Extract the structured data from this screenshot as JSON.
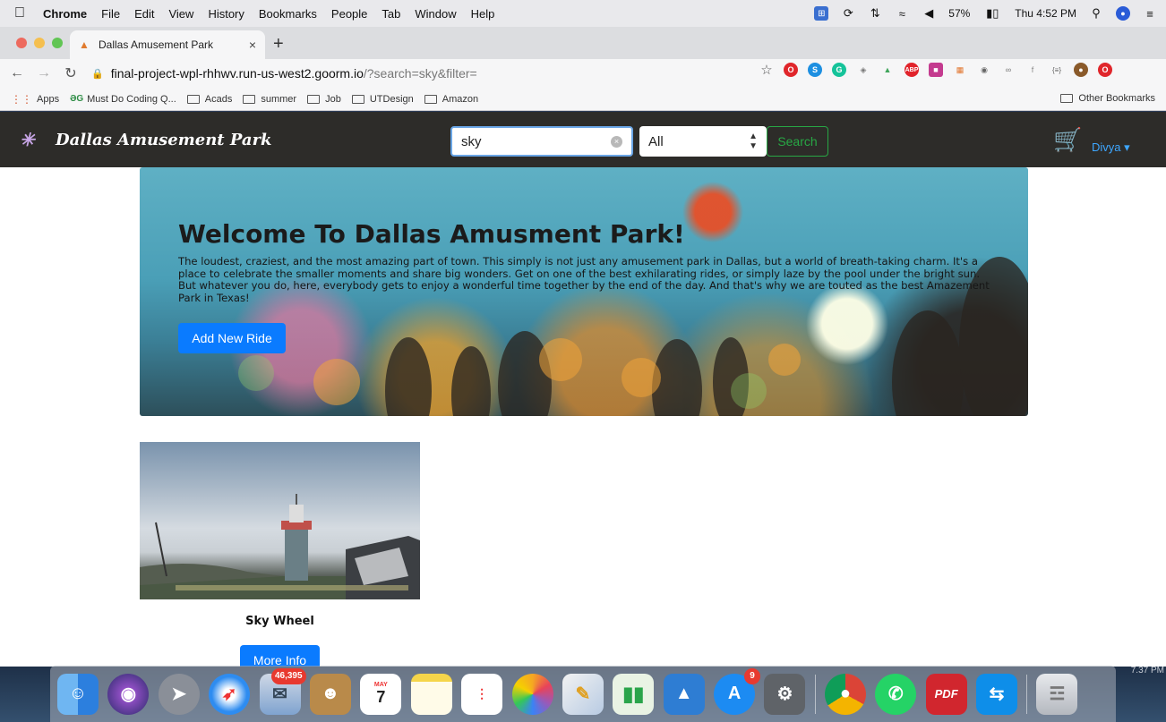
{
  "menubar": {
    "app": "Chrome",
    "items": [
      "File",
      "Edit",
      "View",
      "History",
      "Bookmarks",
      "People",
      "Tab",
      "Window",
      "Help"
    ],
    "battery": "57%",
    "clock": "Thu 4:52 PM"
  },
  "tab": {
    "title": "Dallas Amusement Park"
  },
  "address": {
    "host": "final-project-wpl-rhhwv.run-us-west2.goorm.io",
    "path": "/?search=sky&filter="
  },
  "bookmarks": {
    "items": [
      "Apps",
      "Must Do Coding Q...",
      "Acads",
      "summer",
      "Job",
      "UTDesign",
      "Amazon"
    ],
    "other": "Other Bookmarks"
  },
  "site": {
    "brand": "Dallas Amusement Park",
    "search_value": "sky",
    "filter_value": "All",
    "search_button": "Search",
    "user": "Divya"
  },
  "hero": {
    "title": "Welcome To Dallas Amusment Park!",
    "text": "The loudest, craziest, and the most amazing part of town. This simply is not just any amusement park in Dallas, but a world of breath-taking charm. It's a place to celebrate the smaller moments and share big wonders. Get on one of the best exhilarating rides, or simply laze by the pool under the bright sun. But whatever you do, here, everybody gets to enjoy a wonderful time together by the end of the day. And that's why we are touted as the best Amazement Park in Texas!",
    "button": "Add New Ride"
  },
  "rides": [
    {
      "name": "Sky Wheel",
      "button": "More Info"
    }
  ],
  "dock": {
    "mail_badge": "46,395",
    "calendar_month": "MAY",
    "calendar_day": "7",
    "appstore_badge": "9",
    "pdf_label": "PDF"
  },
  "desktop": {
    "clock_fragment": "7.37 PM"
  }
}
